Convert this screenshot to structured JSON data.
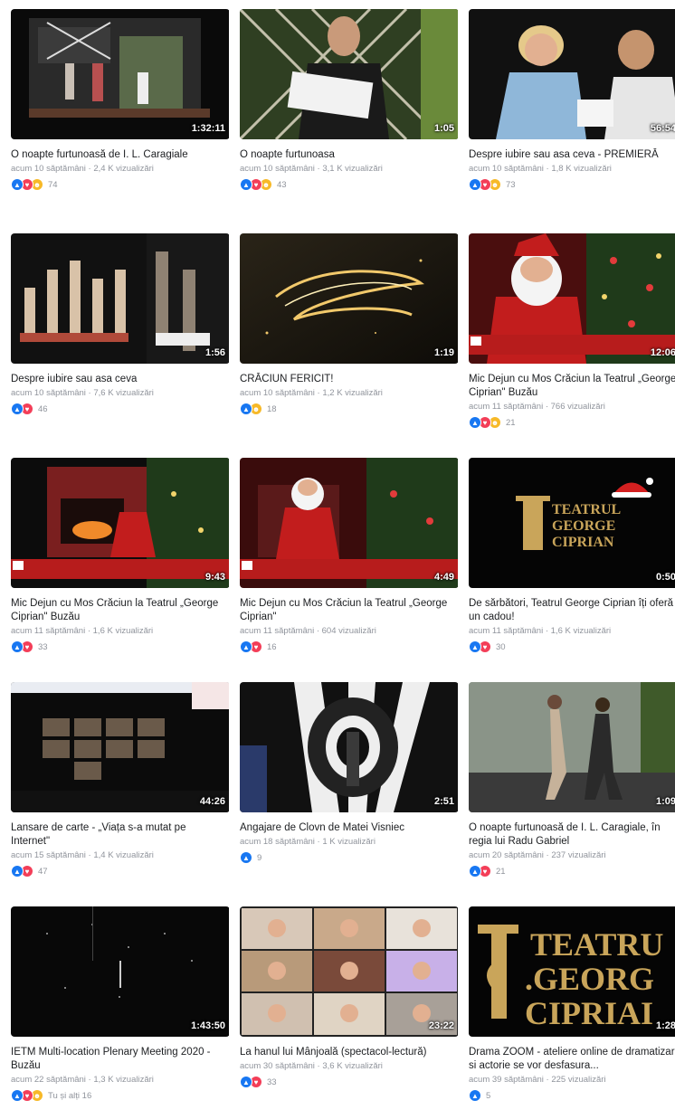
{
  "videos": [
    {
      "title": "O noapte furtunoasă de I. L. Caragiale",
      "meta": "acum 10 săptămâni · 2,4 K vizualizări",
      "duration": "1:32:11",
      "reactions": [
        "like",
        "love",
        "haha"
      ],
      "count": "74"
    },
    {
      "title": "O noapte furtunoasa",
      "meta": "acum 10 săptămâni · 3,1 K vizualizări",
      "duration": "1:05",
      "reactions": [
        "like",
        "love",
        "haha"
      ],
      "count": "43"
    },
    {
      "title": "Despre iubire sau asa ceva - PREMIERĂ",
      "meta": "acum 10 săptămâni · 1,8 K vizualizări",
      "duration": "56:54",
      "reactions": [
        "like",
        "love",
        "haha"
      ],
      "count": "73"
    },
    {
      "title": "Despre iubire sau asa ceva",
      "meta": "acum 10 săptămâni · 7,6 K vizualizări",
      "duration": "1:56",
      "reactions": [
        "like",
        "love"
      ],
      "count": "46"
    },
    {
      "title": "CRĂCIUN FERICIT!",
      "meta": "acum 10 săptămâni · 1,2 K vizualizări",
      "duration": "1:19",
      "reactions": [
        "like",
        "care"
      ],
      "count": "18"
    },
    {
      "title": "Mic Dejun cu Mos Crăciun la Teatrul „George Ciprian\" Buzău",
      "meta": "acum 11 săptămâni · 766 vizualizări",
      "duration": "12:06",
      "reactions": [
        "like",
        "love",
        "care"
      ],
      "count": "21"
    },
    {
      "title": "Mic Dejun cu Mos Crăciun la Teatrul „George Ciprian\" Buzău",
      "meta": "acum 11 săptămâni · 1,6 K vizualizări",
      "duration": "9:43",
      "reactions": [
        "like",
        "love"
      ],
      "count": "33"
    },
    {
      "title": "Mic Dejun cu Mos Crăciun la Teatrul „George Ciprian\"",
      "meta": "acum 11 săptămâni · 604 vizualizări",
      "duration": "4:49",
      "reactions": [
        "like",
        "love"
      ],
      "count": "16"
    },
    {
      "title": "De sărbători, Teatrul George Ciprian îți oferă un cadou!",
      "meta": "acum 11 săptămâni · 1,6 K vizualizări",
      "duration": "0:50",
      "reactions": [
        "like",
        "love"
      ],
      "count": "30"
    },
    {
      "title": "Lansare de carte - „Viața s-a mutat pe Internet\"",
      "meta": "acum 15 săptămâni · 1,4 K vizualizări",
      "duration": "44:26",
      "reactions": [
        "like",
        "love"
      ],
      "count": "47"
    },
    {
      "title": "Angajare de Clovn de Matei Visniec",
      "meta": "acum 18 săptămâni · 1 K vizualizări",
      "duration": "2:51",
      "reactions": [
        "like"
      ],
      "count": "9"
    },
    {
      "title": "O noapte furtunoasă de I. L. Caragiale, în regia lui Radu Gabriel",
      "meta": "acum 20 săptămâni · 237 vizualizări",
      "duration": "1:09",
      "reactions": [
        "like",
        "love"
      ],
      "count": "21"
    },
    {
      "title": "IETM Multi-location Plenary Meeting 2020 - Buzău",
      "meta": "acum 22 săptămâni · 1,3 K vizualizări",
      "duration": "1:43:50",
      "reactions": [
        "like",
        "love",
        "care"
      ],
      "count": "Tu și alți 16"
    },
    {
      "title": "La hanul lui Mânjoală (spectacol-lectură)",
      "meta": "acum 30 săptămâni · 3,6 K vizualizări",
      "duration": "23:22",
      "reactions": [
        "like",
        "love"
      ],
      "count": "33"
    },
    {
      "title": "Drama ZOOM - ateliere online de dramatizare si actorie se vor desfasura...",
      "meta": "acum 39 săptămâni · 225 vizualizări",
      "duration": "1:28",
      "reactions": [
        "like"
      ],
      "count": "5"
    }
  ],
  "logo": {
    "line1": "TEATRUL",
    "line2": "GEORGE",
    "line3": "CIPRIAN"
  },
  "colors": {
    "like": "#1877f2",
    "love": "#f33e58",
    "haha": "#f7b928",
    "meta": "#90949c"
  }
}
